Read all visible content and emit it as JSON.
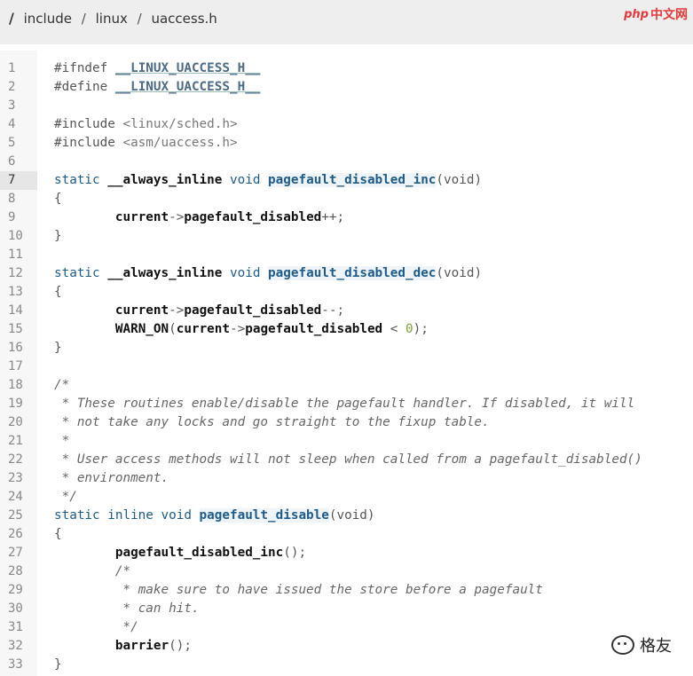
{
  "breadcrumb": {
    "root": "/",
    "parts": [
      "include",
      "linux",
      "uaccess.h"
    ],
    "separator": "/"
  },
  "watermark_top": {
    "php": "php",
    "cn": "中文网"
  },
  "watermark_bottom": {
    "text": "格友"
  },
  "highlighted_line": 7,
  "code_lines": [
    {
      "n": "1",
      "t": [
        [
          "pp",
          "#ifndef "
        ],
        [
          "def",
          "__LINUX_UACCESS_H__"
        ]
      ]
    },
    {
      "n": "2",
      "t": [
        [
          "pp",
          "#define "
        ],
        [
          "def",
          "__LINUX_UACCESS_H__"
        ]
      ]
    },
    {
      "n": "3",
      "t": []
    },
    {
      "n": "4",
      "t": [
        [
          "pp",
          "#include "
        ],
        [
          "inc",
          "<linux/sched.h>"
        ]
      ]
    },
    {
      "n": "5",
      "t": [
        [
          "pp",
          "#include "
        ],
        [
          "inc",
          "<asm/uaccess.h>"
        ]
      ]
    },
    {
      "n": "6",
      "t": []
    },
    {
      "n": "7",
      "t": [
        [
          "kw",
          "static "
        ],
        [
          "call",
          "__always_inline"
        ],
        [
          "kw",
          " void "
        ],
        [
          "fn",
          "pagefault_disabled_inc"
        ],
        [
          "op",
          "(void)"
        ]
      ]
    },
    {
      "n": "8",
      "t": [
        [
          "op",
          "{"
        ]
      ]
    },
    {
      "n": "9",
      "t": [
        [
          "op",
          "        "
        ],
        [
          "call",
          "current"
        ],
        [
          "op",
          "->"
        ],
        [
          "call",
          "pagefault_disabled"
        ],
        [
          "op",
          "++;"
        ]
      ]
    },
    {
      "n": "10",
      "t": [
        [
          "op",
          "}"
        ]
      ]
    },
    {
      "n": "11",
      "t": []
    },
    {
      "n": "12",
      "t": [
        [
          "kw",
          "static "
        ],
        [
          "call",
          "__always_inline"
        ],
        [
          "kw",
          " void "
        ],
        [
          "fn",
          "pagefault_disabled_dec"
        ],
        [
          "op",
          "(void)"
        ]
      ]
    },
    {
      "n": "13",
      "t": [
        [
          "op",
          "{"
        ]
      ]
    },
    {
      "n": "14",
      "t": [
        [
          "op",
          "        "
        ],
        [
          "call",
          "current"
        ],
        [
          "op",
          "->"
        ],
        [
          "call",
          "pagefault_disabled"
        ],
        [
          "op",
          "--;"
        ]
      ]
    },
    {
      "n": "15",
      "t": [
        [
          "op",
          "        "
        ],
        [
          "call",
          "WARN_ON"
        ],
        [
          "op",
          "("
        ],
        [
          "call",
          "current"
        ],
        [
          "op",
          "->"
        ],
        [
          "call",
          "pagefault_disabled"
        ],
        [
          "op",
          " < "
        ],
        [
          "num",
          "0"
        ],
        [
          "op",
          ");"
        ]
      ]
    },
    {
      "n": "16",
      "t": [
        [
          "op",
          "}"
        ]
      ]
    },
    {
      "n": "17",
      "t": []
    },
    {
      "n": "18",
      "t": [
        [
          "cm",
          "/*"
        ]
      ]
    },
    {
      "n": "19",
      "t": [
        [
          "cm",
          " * These routines enable/disable the pagefault handler. If disabled, it will"
        ]
      ]
    },
    {
      "n": "20",
      "t": [
        [
          "cm",
          " * not take any locks and go straight to the fixup table."
        ]
      ]
    },
    {
      "n": "21",
      "t": [
        [
          "cm",
          " *"
        ]
      ]
    },
    {
      "n": "22",
      "t": [
        [
          "cm",
          " * User access methods will not sleep when called from a pagefault_disabled()"
        ]
      ]
    },
    {
      "n": "23",
      "t": [
        [
          "cm",
          " * environment."
        ]
      ]
    },
    {
      "n": "24",
      "t": [
        [
          "cm",
          " */"
        ]
      ]
    },
    {
      "n": "25",
      "t": [
        [
          "kw",
          "static inline void "
        ],
        [
          "fn",
          "pagefault_disable"
        ],
        [
          "op",
          "(void)"
        ]
      ]
    },
    {
      "n": "26",
      "t": [
        [
          "op",
          "{"
        ]
      ]
    },
    {
      "n": "27",
      "t": [
        [
          "op",
          "        "
        ],
        [
          "call",
          "pagefault_disabled_inc"
        ],
        [
          "op",
          "();"
        ]
      ]
    },
    {
      "n": "28",
      "t": [
        [
          "op",
          "        "
        ],
        [
          "cm",
          "/*"
        ]
      ]
    },
    {
      "n": "29",
      "t": [
        [
          "op",
          "        "
        ],
        [
          "cm",
          " * make sure to have issued the store before a pagefault"
        ]
      ]
    },
    {
      "n": "30",
      "t": [
        [
          "op",
          "        "
        ],
        [
          "cm",
          " * can hit."
        ]
      ]
    },
    {
      "n": "31",
      "t": [
        [
          "op",
          "        "
        ],
        [
          "cm",
          " */"
        ]
      ]
    },
    {
      "n": "32",
      "t": [
        [
          "op",
          "        "
        ],
        [
          "call",
          "barrier"
        ],
        [
          "op",
          "();"
        ]
      ]
    },
    {
      "n": "33",
      "t": [
        [
          "op",
          "}"
        ]
      ]
    }
  ]
}
